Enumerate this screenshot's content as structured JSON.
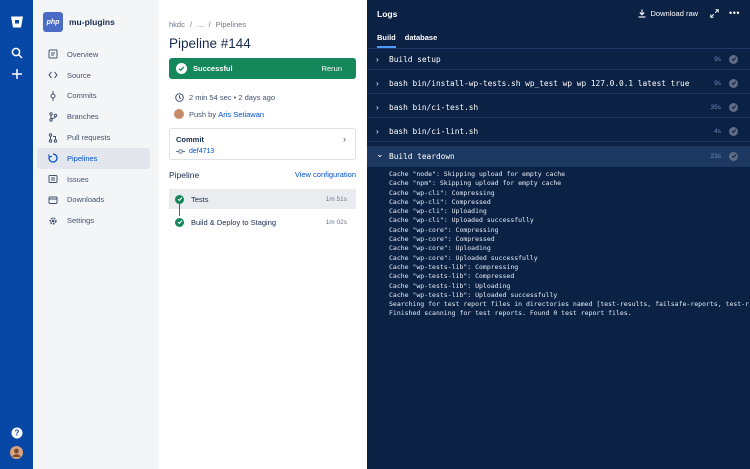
{
  "project": {
    "logo_text": "php",
    "name": "mu-plugins"
  },
  "nav": [
    {
      "label": "Overview",
      "icon": "overview-icon"
    },
    {
      "label": "Source",
      "icon": "source-icon"
    },
    {
      "label": "Commits",
      "icon": "commits-icon"
    },
    {
      "label": "Branches",
      "icon": "branches-icon"
    },
    {
      "label": "Pull requests",
      "icon": "pull-requests-icon"
    },
    {
      "label": "Pipelines",
      "icon": "pipelines-icon",
      "active": true
    },
    {
      "label": "Issues",
      "icon": "issues-icon"
    },
    {
      "label": "Downloads",
      "icon": "downloads-icon"
    },
    {
      "label": "Settings",
      "icon": "settings-icon"
    }
  ],
  "breadcrumb": {
    "owner": "hkdc",
    "sep1": "/",
    "ellipsis": "...",
    "sep2": "/",
    "section": "Pipelines"
  },
  "pipeline": {
    "title": "Pipeline #144",
    "status": "Successful",
    "rerun": "Rerun",
    "duration": "2 min 54 sec • 2 days ago",
    "push_prefix": "Push by",
    "author": "Aris Setiawan",
    "commit_title": "Commit",
    "commit_hash": "def4713",
    "section_title": "Pipeline",
    "view_config": "View configuration",
    "steps": [
      {
        "name": "Tests",
        "duration": "1m 51s"
      },
      {
        "name": "Build & Deploy to Staging",
        "duration": "1m 02s"
      }
    ]
  },
  "logs": {
    "title": "Logs",
    "download": "Download raw",
    "tabs": [
      "Build",
      "database"
    ],
    "rows": [
      {
        "cmd": "Build setup",
        "duration": "9s"
      },
      {
        "cmd": "bash bin/install-wp-tests.sh wp_test wp wp 127.0.0.1 latest true",
        "duration": "9s"
      },
      {
        "cmd": "bash bin/ci-test.sh",
        "duration": "35s"
      },
      {
        "cmd": "bash bin/ci-lint.sh",
        "duration": "4s"
      },
      {
        "cmd": "Build teardown",
        "duration": "23s"
      }
    ],
    "output": [
      "Cache \"node\": Skipping upload for empty cache",
      "Cache \"npm\": Skipping upload for empty cache",
      "Cache \"wp-cli\": Compressing",
      "Cache \"wp-cli\": Compressed",
      "Cache \"wp-cli\": Uploading",
      "Cache \"wp-cli\": Uploaded successfully",
      "Cache \"wp-core\": Compressing",
      "Cache \"wp-core\": Compressed",
      "Cache \"wp-core\": Uploading",
      "Cache \"wp-core\": Uploaded successfully",
      "Cache \"wp-tests-lib\": Compressing",
      "Cache \"wp-tests-lib\": Compressed",
      "Cache \"wp-tests-lib\": Uploading",
      "Cache \"wp-tests-lib\": Uploaded successfully",
      "Searching for test report files in directories named [test-results, failsafe-reports, test-repor",
      "Finished scanning for test reports. Found 0 test report files."
    ]
  },
  "colors": {
    "rail": "#0747a6",
    "success": "#14875b",
    "logs_bg": "#0c2245",
    "link": "#0052cc"
  }
}
